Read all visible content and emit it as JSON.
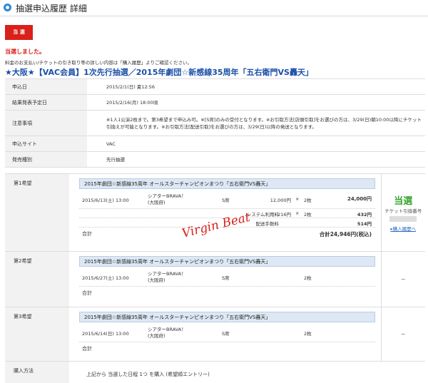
{
  "header": {
    "title": "抽選申込履歴 詳細"
  },
  "status_badge": "当 選",
  "result_text": "当選しました。",
  "notice": "料金のお支払い/チケットの引き取り等の詳しい内容は「購入履歴」よりご確認ください。",
  "event_title": "★大阪★【VAC会員】1次先行抽選／2015年劇団☆新感線35周年「五右衛門VS轟天」",
  "info": [
    {
      "label": "申込日",
      "value": "2015/2/1(日) 夏12:56"
    },
    {
      "label": "結果発表予定日",
      "value": "2015/2/16(月) 18:00頃"
    },
    {
      "label": "注意事項",
      "value": "※1人1公演2枚まで。第3希望まで申込み可。※[S席]のみの受付となります。※お引取方法[店頭引取]をお選びの方は、3/29(日)朝10:00以降にチケット引換えが可能となります。※お引取方法[配送引取]をお選びの方は、3/29(日)以降の発送となります。"
    },
    {
      "label": "申込サイト",
      "value": "VAC"
    },
    {
      "label": "発売種別",
      "value": "先行抽選"
    }
  ],
  "choices": [
    {
      "label": "第1希望",
      "header": "2015年劇団☆新感線35周年 オールスターチャンピオンまつり「五右衛門VS轟天」",
      "date": "2015/6/13(土) 13:00",
      "venue": "シアターBRAVA！(大阪府)",
      "seat": "S席",
      "unit_price": "12,000円",
      "times": "×",
      "qty": "2枚",
      "amount": "24,000円",
      "fees": [
        {
          "name": "システム利用料",
          "unit": "216円",
          "times": "×",
          "qty": "2枚",
          "amount": "432円"
        },
        {
          "name": "配送手数料",
          "unit": "",
          "times": "",
          "qty": "",
          "amount": "514円"
        }
      ],
      "total_label": "合計",
      "total_value": "合計24,946円(税込)",
      "result": {
        "won": "当選",
        "ticket_label": "チケット引換番号",
        "link": "▸購入履歴へ"
      }
    },
    {
      "label": "第2希望",
      "header": "2015年劇団☆新感線35周年 オールスターチャンピオンまつり「五右衛門VS轟天」",
      "date": "2015/6/27(土) 13:00",
      "venue": "シアターBRAVA！(大阪府)",
      "seat": "S席",
      "qty": "2枚",
      "total_label": "合計",
      "result_text": "－"
    },
    {
      "label": "第3希望",
      "header": "2015年劇団☆新感線35周年 オールスターチャンピオンまつり「五右衛門VS轟天」",
      "date": "2015/6/14(日) 13:00",
      "venue": "シアターBRAVA！(大阪府)",
      "seat": "S席",
      "qty": "2枚",
      "total_label": "合計",
      "result_text": "－"
    }
  ],
  "purchase": {
    "label": "購入方法",
    "value": "上記から 当選した日程 1つ を購入 (希望順エントリー)"
  },
  "watermark": "Virgin Beat",
  "colors": {
    "accent_blue": "#2e86d6",
    "badge_red": "#d9201a",
    "won_green": "#3aa52f",
    "title_blue": "#1a4fa8"
  }
}
